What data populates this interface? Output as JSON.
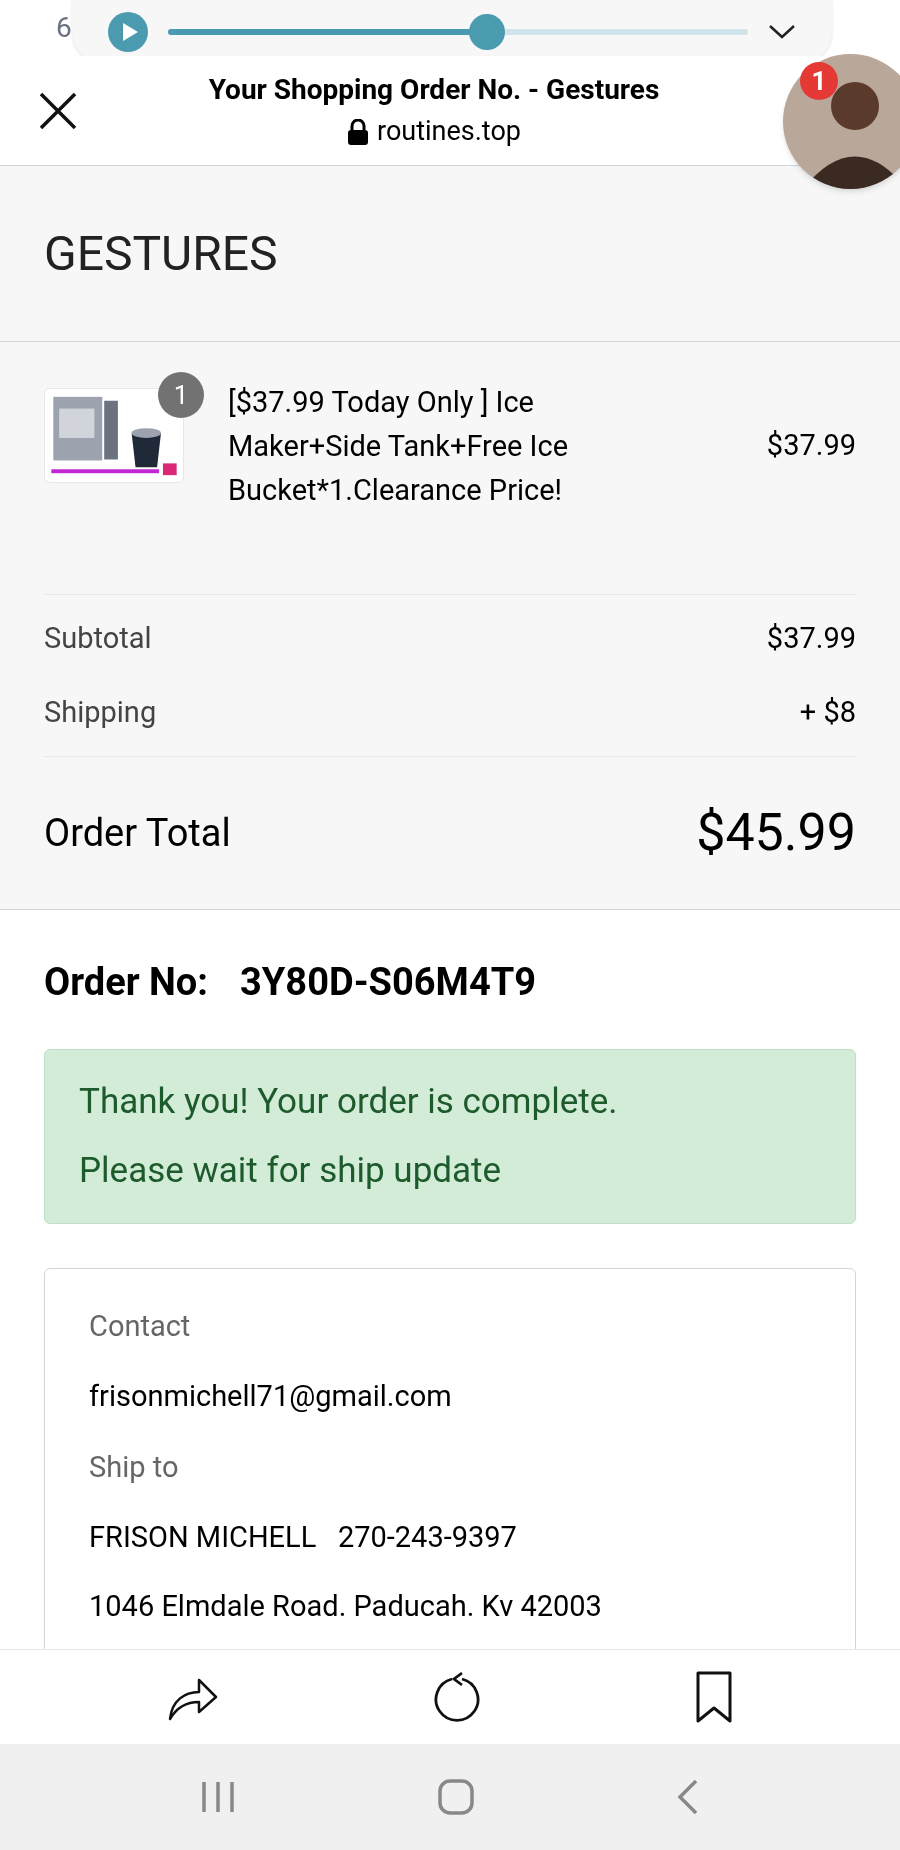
{
  "status_bar": {
    "time": "6"
  },
  "media_player": {
    "level": 0.55
  },
  "header": {
    "title": "Your Shopping Order No. - Gestures",
    "url": "routines.top",
    "avatar_badge": "1"
  },
  "store": {
    "name": "GESTURES"
  },
  "items": [
    {
      "quantity": "1",
      "name": "[$37.99 Today Only ] Ice Maker+Side Tank+Free Ice Bucket*1.Clearance Price!",
      "price": "$37.99"
    }
  ],
  "summary": [
    {
      "label": "Subtotal",
      "value": "$37.99"
    },
    {
      "label": "Shipping",
      "value": "+ $8"
    }
  ],
  "total": {
    "label": "Order Total",
    "value": "$45.99"
  },
  "order": {
    "label": "Order No:",
    "number": "3Y80D-S06M4T9"
  },
  "notice": [
    "Thank you! Your order is complete.",
    "Please wait for ship update"
  ],
  "details": [
    {
      "heading": "Contact",
      "lines": [
        "frisonmichell71@gmail.com"
      ]
    },
    {
      "heading": "Ship to",
      "lines": [
        "FRISON MICHELL   270-243-9397",
        "1046 Elmdale Road. Paducah. Kv 42003"
      ]
    }
  ]
}
